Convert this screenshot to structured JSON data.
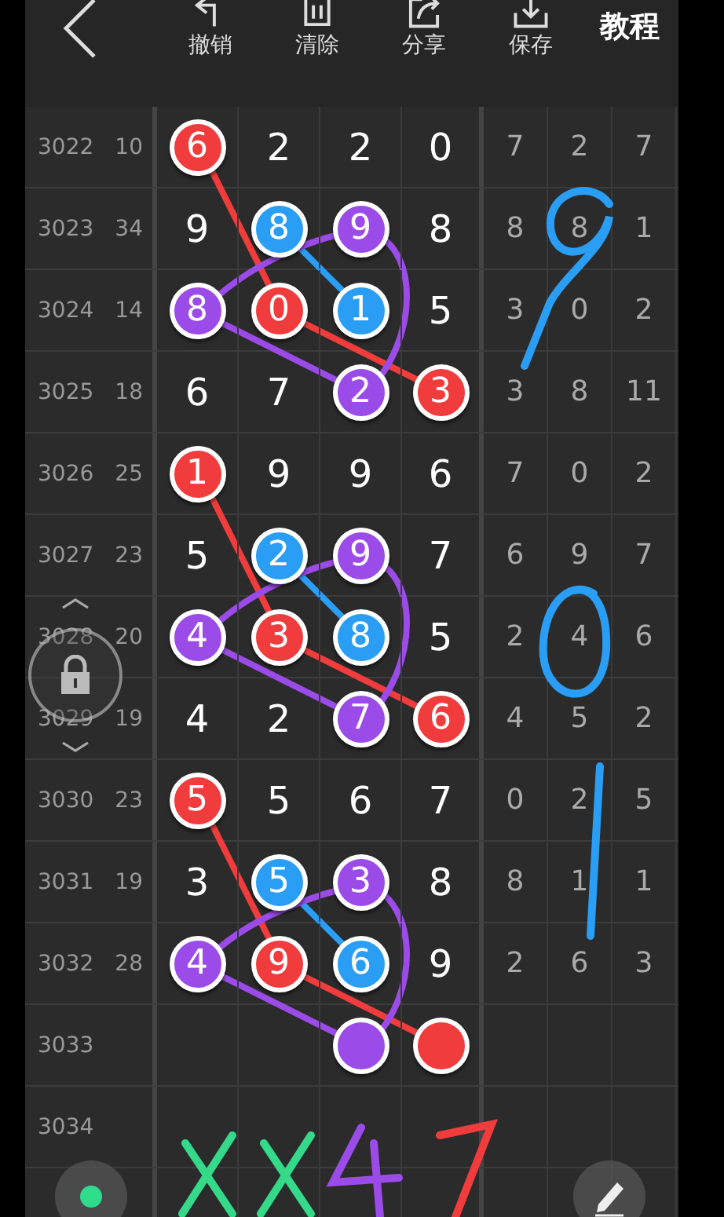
{
  "toolbar": {
    "actions": [
      {
        "label": "撤销"
      },
      {
        "label": "清除"
      },
      {
        "label": "分享"
      },
      {
        "label": "保存"
      }
    ],
    "tutorial": "教程"
  },
  "rows": [
    {
      "period": "3022",
      "sum": "10",
      "digits": [
        {
          "value": "6",
          "color": "#f03c3c"
        },
        {
          "value": "2"
        },
        {
          "value": "2"
        },
        {
          "value": "0"
        }
      ],
      "trend": [
        "7",
        "2",
        "7"
      ]
    },
    {
      "period": "3023",
      "sum": "34",
      "digits": [
        {
          "value": "9"
        },
        {
          "value": "8",
          "color": "#2a9df4"
        },
        {
          "value": "9",
          "color": "#9b4be8"
        },
        {
          "value": "8"
        }
      ],
      "trend": [
        "8",
        "8",
        "1"
      ]
    },
    {
      "period": "3024",
      "sum": "14",
      "digits": [
        {
          "value": "8",
          "color": "#9b4be8"
        },
        {
          "value": "0",
          "color": "#f03c3c"
        },
        {
          "value": "1",
          "color": "#2a9df4"
        },
        {
          "value": "5"
        }
      ],
      "trend": [
        "3",
        "0",
        "2"
      ]
    },
    {
      "period": "3025",
      "sum": "18",
      "digits": [
        {
          "value": "6"
        },
        {
          "value": "7"
        },
        {
          "value": "2",
          "color": "#9b4be8"
        },
        {
          "value": "3",
          "color": "#f03c3c"
        }
      ],
      "trend": [
        "3",
        "8",
        "11"
      ]
    },
    {
      "period": "3026",
      "sum": "25",
      "digits": [
        {
          "value": "1",
          "color": "#f03c3c"
        },
        {
          "value": "9"
        },
        {
          "value": "9"
        },
        {
          "value": "6"
        }
      ],
      "trend": [
        "7",
        "0",
        "2"
      ]
    },
    {
      "period": "3027",
      "sum": "23",
      "digits": [
        {
          "value": "5"
        },
        {
          "value": "2",
          "color": "#2a9df4"
        },
        {
          "value": "9",
          "color": "#9b4be8"
        },
        {
          "value": "7"
        }
      ],
      "trend": [
        "6",
        "9",
        "7"
      ]
    },
    {
      "period": "3028",
      "sum": "20",
      "digits": [
        {
          "value": "4",
          "color": "#9b4be8"
        },
        {
          "value": "3",
          "color": "#f03c3c"
        },
        {
          "value": "8",
          "color": "#2a9df4"
        },
        {
          "value": "5"
        }
      ],
      "trend": [
        "2",
        "4",
        "6"
      ]
    },
    {
      "period": "3029",
      "sum": "19",
      "digits": [
        {
          "value": "4"
        },
        {
          "value": "2"
        },
        {
          "value": "7",
          "color": "#9b4be8"
        },
        {
          "value": "6",
          "color": "#f03c3c"
        }
      ],
      "trend": [
        "4",
        "5",
        "2"
      ]
    },
    {
      "period": "3030",
      "sum": "23",
      "digits": [
        {
          "value": "5",
          "color": "#f03c3c"
        },
        {
          "value": "5"
        },
        {
          "value": "6"
        },
        {
          "value": "7"
        }
      ],
      "trend": [
        "0",
        "2",
        "5"
      ]
    },
    {
      "period": "3031",
      "sum": "19",
      "digits": [
        {
          "value": "3"
        },
        {
          "value": "5",
          "color": "#2a9df4"
        },
        {
          "value": "3",
          "color": "#9b4be8"
        },
        {
          "value": "8"
        }
      ],
      "trend": [
        "8",
        "1",
        "1"
      ]
    },
    {
      "period": "3032",
      "sum": "28",
      "digits": [
        {
          "value": "4",
          "color": "#9b4be8"
        },
        {
          "value": "9",
          "color": "#f03c3c"
        },
        {
          "value": "6",
          "color": "#2a9df4"
        },
        {
          "value": "9"
        }
      ],
      "trend": [
        "2",
        "6",
        "3"
      ]
    },
    {
      "period": "3033",
      "balls": [
        {
          "color": "#9b4be8"
        },
        {
          "color": "#f03c3c"
        }
      ]
    },
    {
      "period": "3034"
    }
  ]
}
